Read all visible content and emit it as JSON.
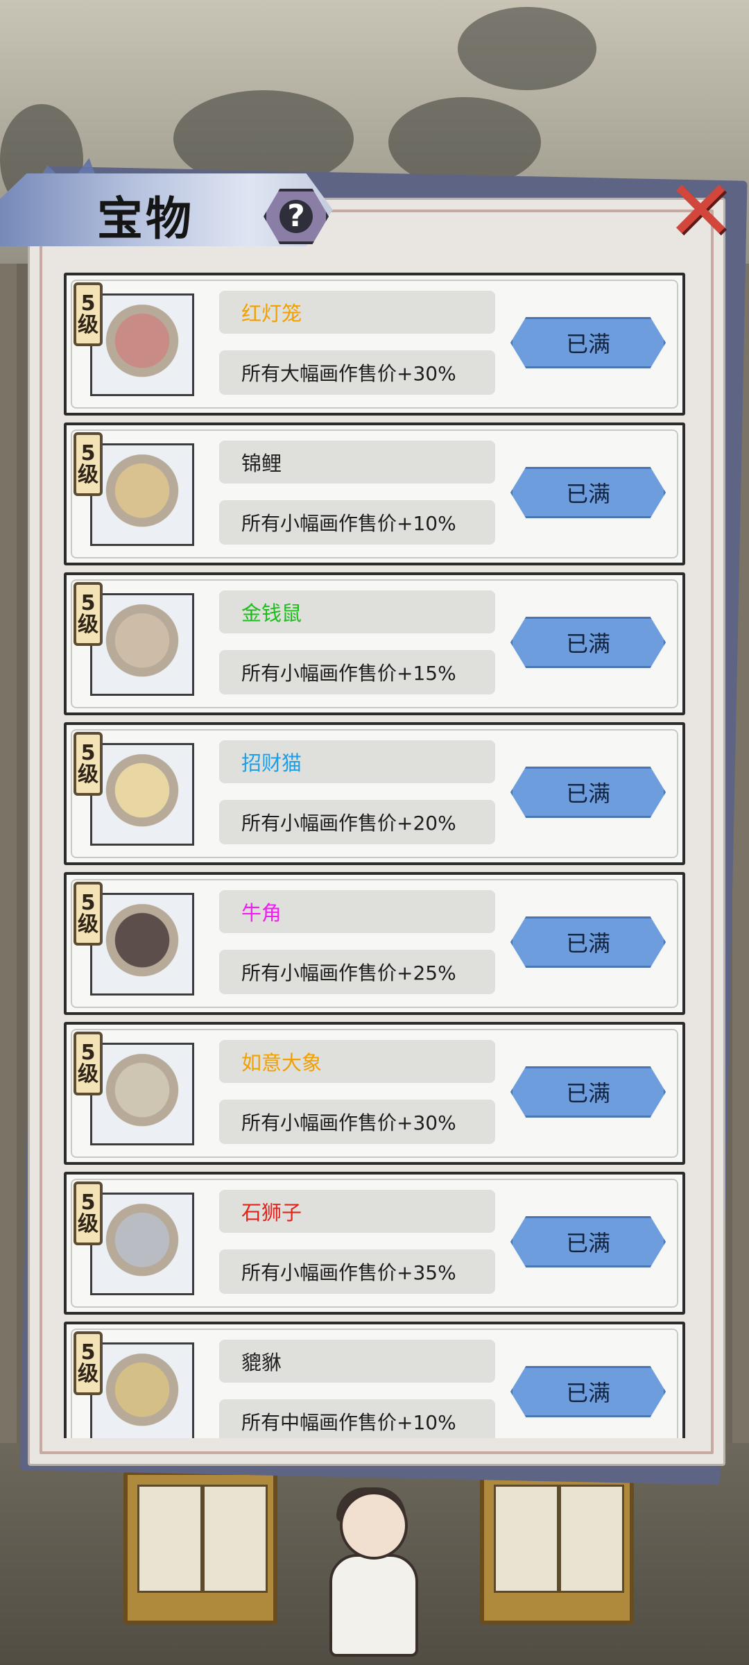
{
  "header": {
    "title": "宝物",
    "help_symbol": "?",
    "close_symbol": "✕"
  },
  "colors": {
    "orange": "#f2a000",
    "green": "#1dbd1d",
    "blue": "#1f9ee8",
    "magenta": "#f01ef0",
    "red": "#e2241b",
    "default": "#222222",
    "button": "#6d9ddd"
  },
  "items": [
    {
      "level_num": "5",
      "level_unit": "级",
      "name": "红灯笼",
      "name_color": "#f2a000",
      "desc": "所有大幅画作售价+30%",
      "button": "已满",
      "icon": "lantern-icon",
      "art_color": "#c98b86"
    },
    {
      "level_num": "5",
      "level_unit": "级",
      "name": "锦鲤",
      "name_color": "#222222",
      "desc": "所有小幅画作售价+10%",
      "button": "已满",
      "icon": "koi-icon",
      "art_color": "#d9c28f"
    },
    {
      "level_num": "5",
      "level_unit": "级",
      "name": "金钱鼠",
      "name_color": "#1dbd1d",
      "desc": "所有小幅画作售价+15%",
      "button": "已满",
      "icon": "money-rat-icon",
      "art_color": "#cdbca8"
    },
    {
      "level_num": "5",
      "level_unit": "级",
      "name": "招财猫",
      "name_color": "#1f9ee8",
      "desc": "所有小幅画作售价+20%",
      "button": "已满",
      "icon": "lucky-cat-icon",
      "art_color": "#e8d6a3"
    },
    {
      "level_num": "5",
      "level_unit": "级",
      "name": "牛角",
      "name_color": "#f01ef0",
      "desc": "所有小幅画作售价+25%",
      "button": "已满",
      "icon": "ox-horn-icon",
      "art_color": "#5c4e4a"
    },
    {
      "level_num": "5",
      "level_unit": "级",
      "name": "如意大象",
      "name_color": "#f2a000",
      "desc": "所有小幅画作售价+30%",
      "button": "已满",
      "icon": "elephant-icon",
      "art_color": "#cfc5b3"
    },
    {
      "level_num": "5",
      "level_unit": "级",
      "name": "石狮子",
      "name_color": "#e2241b",
      "desc": "所有小幅画作售价+35%",
      "button": "已满",
      "icon": "stone-lion-icon",
      "art_color": "#b9bcc2"
    },
    {
      "level_num": "5",
      "level_unit": "级",
      "name": "貔貅",
      "name_color": "#222222",
      "desc": "所有中幅画作售价+10%",
      "button": "已满",
      "icon": "pixiu-icon",
      "art_color": "#d4bf86"
    }
  ]
}
